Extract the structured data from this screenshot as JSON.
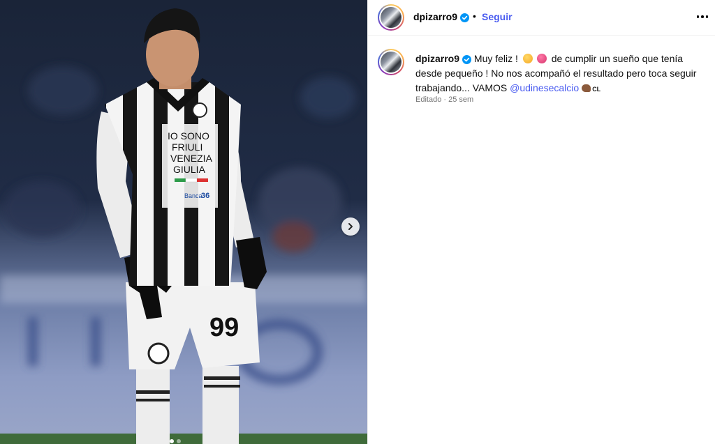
{
  "post": {
    "username": "dpizarro9",
    "follow_label": "Seguir",
    "separator": "•",
    "caption_part1": "Muy feliz !",
    "caption_part2": "de cumplir un sueño que tenía desde pequeño ! No nos acompañó el resultado pero toca seguir trabajando... VAMOS",
    "mention": "@udinesecalcio",
    "flag_text": "CL",
    "meta": "Editado · 25 sem"
  },
  "photo": {
    "jersey_text": [
      "IO SONO",
      "FRIULI",
      "VENEZIA",
      "GIULIA"
    ],
    "sponsor": "Banca",
    "sponsor_num": "36",
    "shirt_number": "99"
  },
  "icons": {
    "verified": "verified-badge-icon",
    "more": "more-options-icon",
    "next": "chevron-right-icon"
  },
  "colors": {
    "accent": "#4a5cf0",
    "verified": "#0095f6"
  }
}
